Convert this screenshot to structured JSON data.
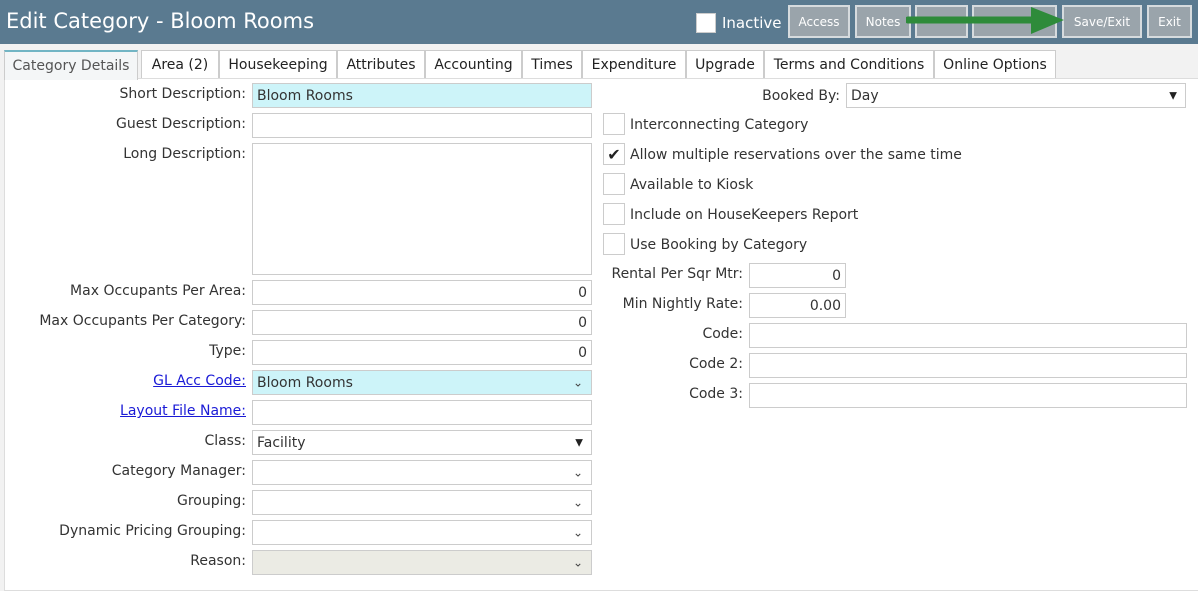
{
  "header": {
    "title": "Edit Category - Bloom Rooms",
    "inactive_label": "Inactive",
    "buttons": {
      "access": "Access",
      "notes": "Notes",
      "save_exit": "Save/Exit",
      "exit": "Exit"
    },
    "arrow_color": "#2e8b3a"
  },
  "tabs": [
    "Category Details",
    "Area (2)",
    "Housekeeping",
    "Attributes",
    "Accounting",
    "Times",
    "Expenditure",
    "Upgrade",
    "Terms and Conditions",
    "Online Options"
  ],
  "left": {
    "short_description": {
      "label": "Short Description:",
      "value": "Bloom Rooms"
    },
    "guest_description": {
      "label": "Guest Description:",
      "value": ""
    },
    "long_description": {
      "label": "Long Description:",
      "value": ""
    },
    "max_occupants_area": {
      "label": "Max Occupants Per Area:",
      "value": "0"
    },
    "max_occupants_category": {
      "label": "Max Occupants Per Category:",
      "value": "0"
    },
    "type": {
      "label": "Type:",
      "value": "0"
    },
    "gl_acc_code": {
      "label": "GL Acc Code:",
      "value": "Bloom Rooms"
    },
    "layout_file_name": {
      "label": "Layout File Name:",
      "value": ""
    },
    "class": {
      "label": "Class:",
      "value": "Facility"
    },
    "category_manager": {
      "label": "Category Manager:",
      "value": ""
    },
    "grouping": {
      "label": "Grouping:",
      "value": ""
    },
    "dynamic_pricing_grouping": {
      "label": "Dynamic Pricing Grouping:",
      "value": ""
    },
    "reason": {
      "label": "Reason:",
      "value": ""
    }
  },
  "right": {
    "booked_by": {
      "label": "Booked By:",
      "value": "Day"
    },
    "checkboxes": {
      "interconnecting": {
        "label": "Interconnecting Category",
        "checked": false
      },
      "allow_multiple": {
        "label": "Allow multiple reservations over the same time",
        "checked": true
      },
      "kiosk": {
        "label": "Available to Kiosk",
        "checked": false
      },
      "housekeepers": {
        "label": "Include on HouseKeepers Report",
        "checked": false
      },
      "booking_by_category": {
        "label": "Use Booking by Category",
        "checked": false
      }
    },
    "rental_per_sqr_mtr": {
      "label": "Rental Per Sqr Mtr:",
      "value": "0"
    },
    "min_nightly_rate": {
      "label": "Min Nightly Rate:",
      "value": "0.00"
    },
    "code": {
      "label": "Code:",
      "value": ""
    },
    "code2": {
      "label": "Code 2:",
      "value": ""
    },
    "code3": {
      "label": "Code 3:",
      "value": ""
    }
  }
}
